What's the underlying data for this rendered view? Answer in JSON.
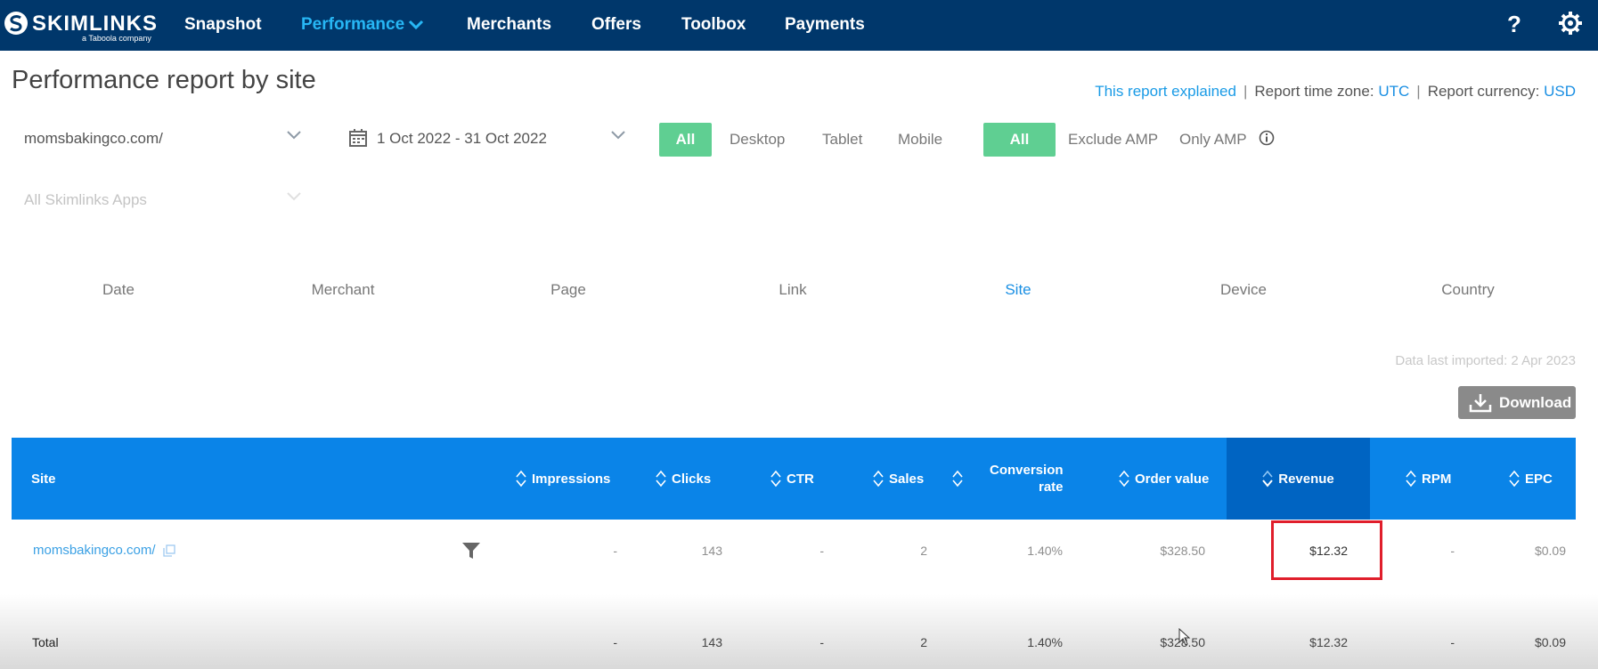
{
  "nav": {
    "logo": "SKIMLINKS",
    "logo_sub": "a Taboola company",
    "items": [
      "Snapshot",
      "Performance",
      "Merchants",
      "Offers",
      "Toolbox",
      "Payments"
    ],
    "help": "?"
  },
  "header": {
    "title": "Performance report by site",
    "explained": "This report explained",
    "timezone_label": "Report time zone:",
    "timezone": "UTC",
    "currency_label": "Report currency:",
    "currency": "USD"
  },
  "filters": {
    "site": "momsbakingco.com/",
    "date_range": "1 Oct 2022 - 31 Oct 2022",
    "apps_placeholder": "All Skimlinks Apps",
    "device": [
      "All",
      "Desktop",
      "Tablet",
      "Mobile"
    ],
    "amp": [
      "All",
      "Exclude AMP",
      "Only AMP"
    ]
  },
  "tabs": [
    "Date",
    "Merchant",
    "Page",
    "Link",
    "Site",
    "Device",
    "Country"
  ],
  "active_tab": "Site",
  "imported": "Data last imported: 2 Apr 2023",
  "download": "Download",
  "table": {
    "headers": {
      "site": "Site",
      "impressions": "Impressions",
      "clicks": "Clicks",
      "ctr": "CTR",
      "sales": "Sales",
      "conv_line1": "Conversion",
      "conv_line2": "rate",
      "order_value": "Order value",
      "revenue": "Revenue",
      "rpm": "RPM",
      "epc": "EPC"
    },
    "row": {
      "site": "momsbakingco.com/",
      "impressions": "-",
      "clicks": "143",
      "ctr": "-",
      "sales": "2",
      "conversion": "1.40%",
      "order_value": "$328.50",
      "revenue": "$12.32",
      "rpm": "-",
      "epc": "$0.09"
    },
    "total": {
      "label": "Total",
      "impressions": "-",
      "clicks": "143",
      "ctr": "-",
      "sales": "2",
      "conversion": "1.40%",
      "order_value": "$328.50",
      "revenue": "$12.32",
      "rpm": "-",
      "epc": "$0.09"
    }
  },
  "colors": {
    "nav_bg": "#00376b",
    "accent_blue": "#1a8fe3",
    "table_header": "#0a84e8",
    "sorted_header": "#0064c2",
    "toggle_green": "#5fcf92",
    "highlight_red": "#e01e2b"
  }
}
